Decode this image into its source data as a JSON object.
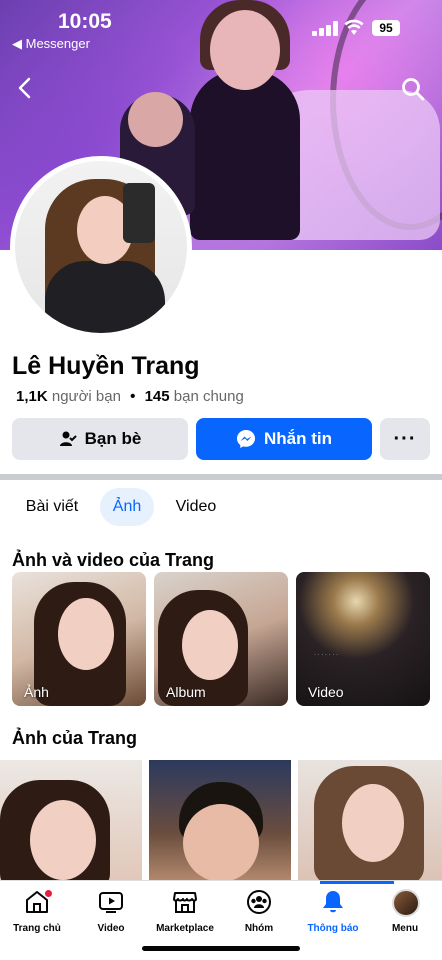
{
  "status_bar": {
    "time": "10:05",
    "back_app": "◀ Messenger",
    "battery": "95"
  },
  "profile": {
    "name": "Lê Huyền Trang",
    "friends_count": "1,1K",
    "friends_label": "người bạn",
    "separator": "•",
    "mutual_count": "145",
    "mutual_label": "bạn chung"
  },
  "actions": {
    "friends_button": "Bạn bè",
    "message_button": "Nhắn tin",
    "more_button": "···"
  },
  "tabs": [
    {
      "label": "Bài viết"
    },
    {
      "label": "Ảnh",
      "active": true
    },
    {
      "label": "Video"
    }
  ],
  "sections": {
    "albums_title": "Ảnh và video của Trang",
    "albums": [
      {
        "label": "Ảnh"
      },
      {
        "label": "Album"
      },
      {
        "label": "Video"
      }
    ],
    "photos_title": "Ảnh của Trang"
  },
  "bottom_nav": [
    {
      "label": "Trang chủ",
      "icon": "home-icon",
      "has_badge": true
    },
    {
      "label": "Video",
      "icon": "video-icon"
    },
    {
      "label": "Marketplace",
      "icon": "marketplace-icon"
    },
    {
      "label": "Nhóm",
      "icon": "groups-icon"
    },
    {
      "label": "Thông báo",
      "icon": "bell-icon",
      "active": true
    },
    {
      "label": "Menu",
      "icon": "menu-avatar-icon"
    }
  ],
  "colors": {
    "accent": "#0866ff",
    "button_gray": "#e4e6eb",
    "badge": "#e41e3f",
    "text_secondary": "#65676b"
  }
}
